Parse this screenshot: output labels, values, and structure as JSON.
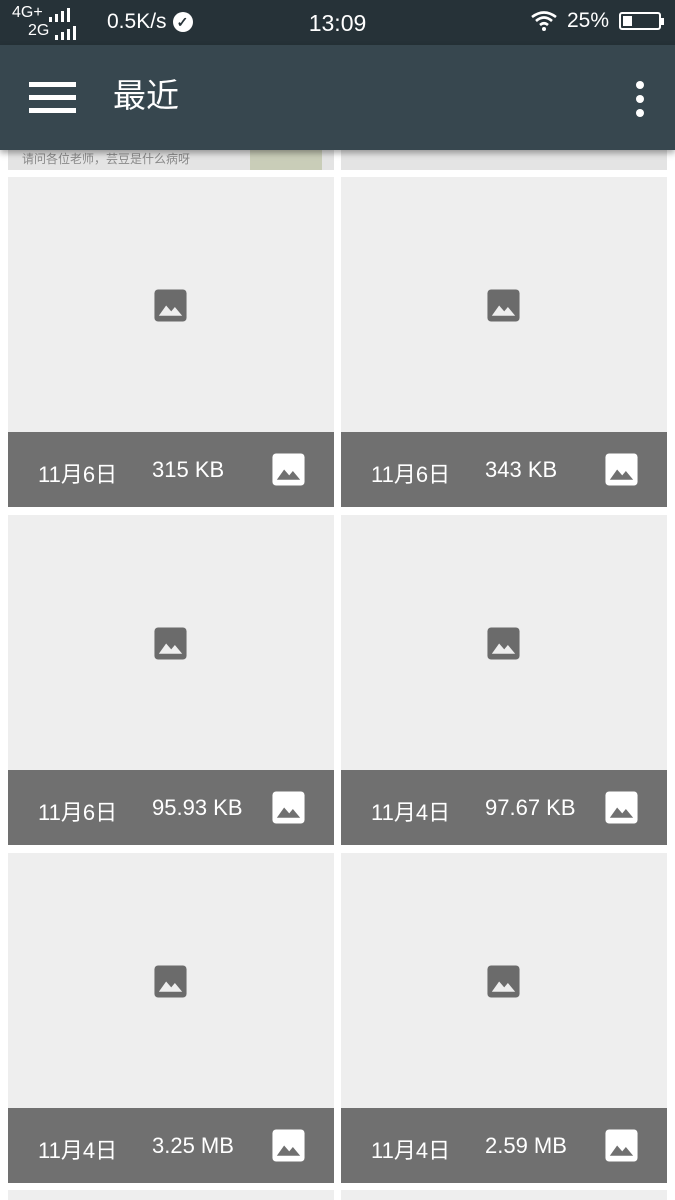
{
  "status_bar": {
    "network_top": "4G+",
    "network_bottom": "2G",
    "speed": "0.5K/s",
    "time": "13:09",
    "battery_text": "25%",
    "battery_level": 0.25
  },
  "app_bar": {
    "title": "最近",
    "menu_icon": "hamburger-menu-icon",
    "more_icon": "more-vert-icon"
  },
  "partial_top_item": {
    "text": "请问各位老师，芸豆是什么病呀"
  },
  "grid": {
    "items": [
      {
        "date": "11月6日",
        "size": "315 KB",
        "type_icon": "image-icon"
      },
      {
        "date": "11月6日",
        "size": "343 KB",
        "type_icon": "image-icon"
      },
      {
        "date": "11月6日",
        "size": "95.93 KB",
        "type_icon": "image-icon"
      },
      {
        "date": "11月4日",
        "size": "97.67 KB",
        "type_icon": "image-icon"
      },
      {
        "date": "11月4日",
        "size": "3.25 MB",
        "type_icon": "image-icon"
      },
      {
        "date": "11月4日",
        "size": "2.59 MB",
        "type_icon": "image-icon"
      }
    ]
  },
  "colors": {
    "status_bar_bg": "#263238",
    "app_bar_bg": "#37474f",
    "card_bg": "#eeeeee",
    "caption_bg": "#707070",
    "placeholder_icon": "#6b6b6b"
  }
}
